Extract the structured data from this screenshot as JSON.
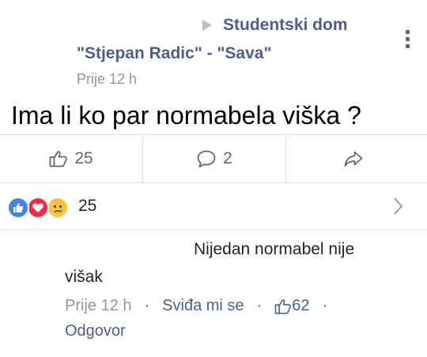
{
  "post": {
    "group_line1": "Studentski dom",
    "group_line2": "\"Stjepan Radic\" - \"Sava\"",
    "timestamp": "Prije 12 h",
    "text": "Ima li ko par normabela viška ?"
  },
  "actions": {
    "like_count": "25",
    "comment_count": "2"
  },
  "reactions": {
    "icons": [
      "like-reaction",
      "love-reaction",
      "sad-reaction"
    ],
    "count": "25"
  },
  "comment": {
    "line1": "Nijedan normabel nije",
    "line2": "višak",
    "timestamp": "Prije 12 h",
    "like_label": "Sviđa mi se",
    "like_count": "62",
    "reply_label": "Odgovor"
  },
  "colors": {
    "link": "#4b5f8d",
    "muted": "#90949c",
    "like_blue": "#4a7ff0",
    "love_red": "#f0284a",
    "sad_yellow": "#f7c43d"
  }
}
